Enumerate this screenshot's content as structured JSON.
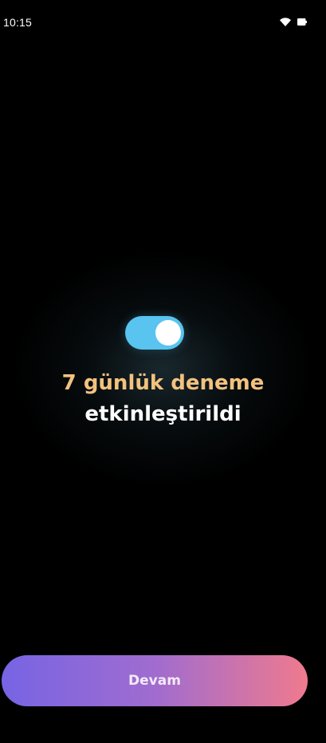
{
  "status_bar": {
    "time": "10:15",
    "icons": [
      "wifi-icon",
      "battery-icon"
    ]
  },
  "toggle": {
    "state": "on",
    "track_color": "#58c4ef",
    "knob_color": "#ffffff"
  },
  "message": {
    "line1": "7 günlük deneme",
    "line2": "etkinleştirildi",
    "line1_color": "#f2c27e",
    "line2_color": "#ffffff"
  },
  "continue_button": {
    "label": "Devam",
    "gradient": [
      "#7764e4",
      "#a06ccf",
      "#ef7a8e"
    ]
  },
  "colors": {
    "background": "#000000"
  }
}
